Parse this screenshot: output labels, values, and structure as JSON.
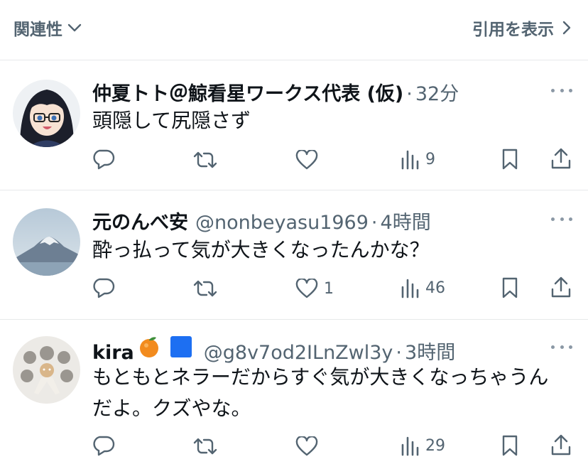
{
  "topbar": {
    "sort_label": "関連性",
    "quotes_label": "引用を表示"
  },
  "posts": [
    {
      "display_name": "仲夏トト＠鯨看星ワークス代表 (仮)",
      "handle": "",
      "time": "32分",
      "text": "頭隠して尻隠さず",
      "replies": "",
      "reposts": "",
      "likes": "",
      "views": "9"
    },
    {
      "display_name": "元のんべ安",
      "handle": "@nonbeyasu1969",
      "time": "4時間",
      "text": "酔っ払って気が大きくなったんかな？",
      "replies": "",
      "reposts": "",
      "likes": "1",
      "views": "46"
    },
    {
      "display_name": "kira",
      "handle": "@g8v7od2ILnZwl3y",
      "time": "3時間",
      "text": "もともとネラーだからすぐ気が大きくなっちゃうんだよ。クズやな。",
      "replies": "",
      "reposts": "",
      "likes": "",
      "views": "29"
    }
  ],
  "colors": {
    "text": "#0f1419",
    "muted": "#536471",
    "divider": "#e7e9ea"
  }
}
